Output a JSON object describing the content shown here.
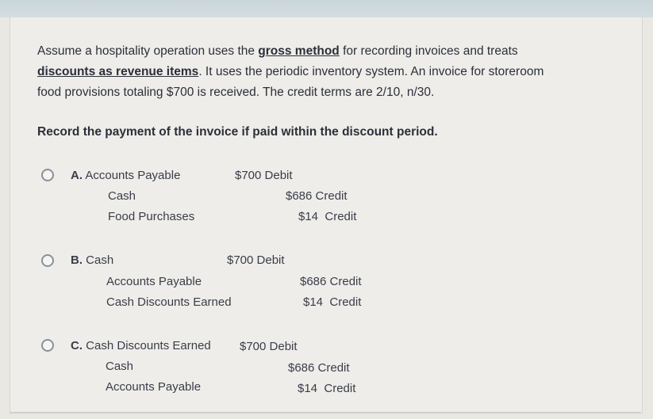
{
  "question": {
    "part1": "Assume a hospitality operation uses the ",
    "emph1": "gross method",
    "part2": " for recording invoices and treats",
    "emph2": "discounts as revenue items",
    "part3": ". It uses the periodic inventory system. An invoice for storeroom",
    "part4": "food provisions totaling $700 is received. The credit terms are 2/10, n/30."
  },
  "prompt": "Record the payment of the invoice if paid within the discount period.",
  "options": [
    {
      "letter": "A.",
      "debit_account": "Accounts Payable",
      "debit_amount": "$700 Debit",
      "credit1_account": "Cash",
      "credit1_amount": "$686 Credit",
      "credit2_account": "Food Purchases",
      "credit2_amount": "$14  Credit",
      "selected": false
    },
    {
      "letter": "B.",
      "debit_account": "Cash",
      "debit_amount": "$700 Debit",
      "credit1_account": "Accounts Payable",
      "credit1_amount": "$686 Credit",
      "credit2_account": "Cash Discounts Earned",
      "credit2_amount": "$14  Credit",
      "selected": false
    },
    {
      "letter": "C.",
      "debit_account": "Cash Discounts Earned",
      "debit_amount": "$700 Debit",
      "credit1_account": "Cash",
      "credit1_amount": "$686 Credit",
      "credit2_account": "Accounts Payable",
      "credit2_amount": "$14  Credit",
      "selected": false
    }
  ]
}
